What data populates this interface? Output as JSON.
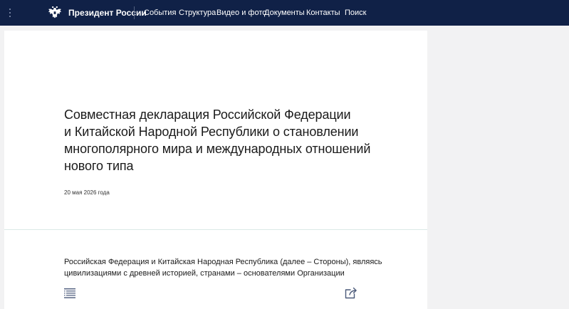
{
  "header": {
    "brand": "Президент России",
    "nav": [
      {
        "label": "События"
      },
      {
        "label": "Структура"
      },
      {
        "label": "Видео и фото"
      },
      {
        "label": "Документы"
      },
      {
        "label": "Контакты"
      },
      {
        "label": "Поиск"
      }
    ]
  },
  "icons": {
    "menu": "vertical-dots-icon",
    "emblem": "double-headed-eagle-icon",
    "toc": "table-of-contents-icon",
    "share": "share-icon"
  },
  "article": {
    "title_lines": [
      "Совместная декларация Российской Федерации",
      "и Китайской Народной Республики о становлении",
      "многополярного мира и международных отношений",
      "нового типа"
    ],
    "date": "20 мая 2026 года",
    "body_lines": [
      "Российская Федерация и Китайская Народная Республика (далее – Стороны), являясь",
      "цивилизациями с древней историей, странами – основателями Организации"
    ]
  },
  "colors": {
    "header_bg": "#102147",
    "page_bg": "#f2f2f3",
    "panel_bg": "#ffffff",
    "text": "#1a1a1a"
  }
}
